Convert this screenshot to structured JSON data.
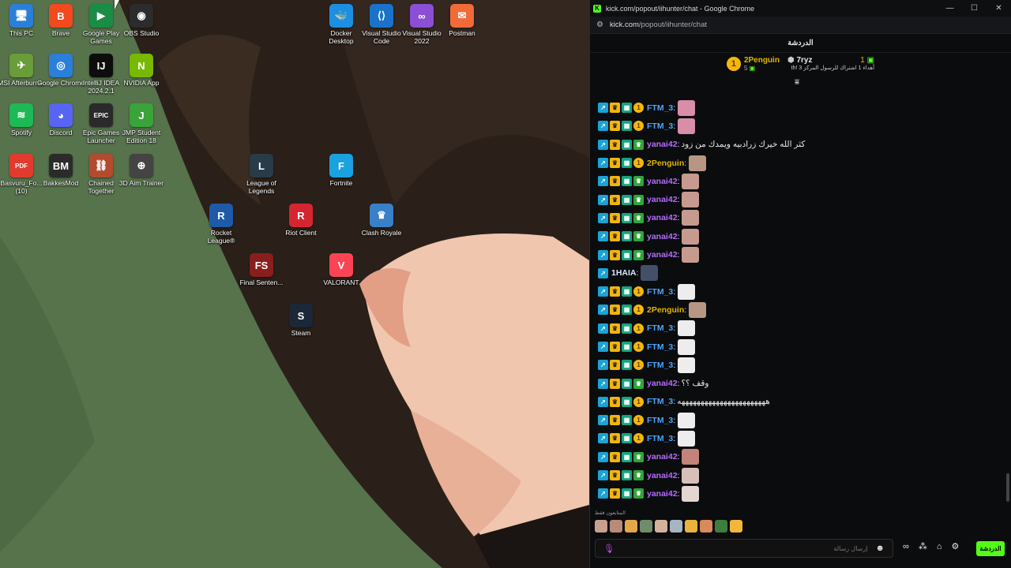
{
  "desktop": {
    "icons": [
      {
        "name": "This PC",
        "color": "#2c7fd8",
        "glyph": "🖥"
      },
      {
        "name": "Brave",
        "color": "#f04a1e",
        "glyph": "B"
      },
      {
        "name": "Google Play Games",
        "color": "#1b8c45",
        "glyph": "▶"
      },
      {
        "name": "OBS Studio",
        "color": "#2c2c2c",
        "glyph": "◉"
      },
      {
        "name": "Docker Desktop",
        "color": "#1d8fe1",
        "glyph": "🐳"
      },
      {
        "name": "Visual Studio Code",
        "color": "#1a73c9",
        "glyph": "⟨⟩"
      },
      {
        "name": "Visual Studio 2022",
        "color": "#8a4fd4",
        "glyph": "∞"
      },
      {
        "name": "Postman",
        "color": "#f06b37",
        "glyph": "✉"
      },
      {
        "name": "MSI Afterburner",
        "color": "#6a9c3a",
        "glyph": "✈"
      },
      {
        "name": "Google Chrome",
        "color": "#2b7fd8",
        "glyph": "◎"
      },
      {
        "name": "IntelliJ IDEA 2024.2.1",
        "color": "#0d0d0d",
        "glyph": "IJ"
      },
      {
        "name": "NVIDIA App",
        "color": "#76b900",
        "glyph": "N"
      },
      {
        "name": "Spotify",
        "color": "#1db954",
        "glyph": "≋"
      },
      {
        "name": "Discord",
        "color": "#5865f2",
        "glyph": "◕"
      },
      {
        "name": "Epic Games Launcher",
        "color": "#2a2a2a",
        "glyph": "EPIC"
      },
      {
        "name": "JMP Student Edition 18",
        "color": "#3aa33a",
        "glyph": "J"
      },
      {
        "name": "Basvuru_Fo... (10)",
        "color": "#e23b2e",
        "glyph": "PDF"
      },
      {
        "name": "BakkesMod",
        "color": "#2b2b2b",
        "glyph": "BM"
      },
      {
        "name": "Chained Together",
        "color": "#b34b2e",
        "glyph": "⛓"
      },
      {
        "name": "3D Aim Trainer",
        "color": "#444",
        "glyph": "⊕"
      },
      {
        "name": "League of Legends",
        "color": "#2a3b48",
        "glyph": "L"
      },
      {
        "name": "Fortnite",
        "color": "#1aa2e0",
        "glyph": "F"
      },
      {
        "name": "Rocket League®",
        "color": "#1e5aa8",
        "glyph": "R"
      },
      {
        "name": "Riot Client",
        "color": "#d42631",
        "glyph": "R"
      },
      {
        "name": "Clash Royale",
        "color": "#3a80c8",
        "glyph": "♛"
      },
      {
        "name": "Final Senten...",
        "color": "#8a1e1e",
        "glyph": "FS"
      },
      {
        "name": "VALORANT",
        "color": "#fa4454",
        "glyph": "V"
      },
      {
        "name": "Steam",
        "color": "#1b2838",
        "glyph": "S"
      }
    ]
  },
  "window": {
    "title": "kick.com/popout/iihunter/chat - Google Chrome",
    "favicon": "K",
    "min": "—",
    "max": "☐",
    "close": "✕",
    "url_host": "kick.com",
    "url_path": "/popout/iihunter/chat"
  },
  "chat": {
    "header": "الدردشة",
    "pinned": {
      "gifter_user": "2Penguin",
      "gifter_count": "5",
      "coin_value": "1",
      "target_user": "7ryz",
      "target_count": "1",
      "message": "أهداء 1 اشتراك للرسول المركز 3 !th"
    },
    "messages": [
      {
        "user": "FTM_3",
        "color": "#4aa6ff",
        "badge": "coin",
        "text": "",
        "emote": "#d98ea8"
      },
      {
        "user": "FTM_3",
        "color": "#4aa6ff",
        "badge": "coin",
        "text": "",
        "emote": "#d98ea8"
      },
      {
        "user": "yanai42",
        "color": "#b46cff",
        "badge": "sub",
        "text": "كثر الله خيرك زرادبيه ويمدك من زود",
        "emote": ""
      },
      {
        "user": "2Penguin",
        "color": "#e0b400",
        "badge": "coin",
        "text": "",
        "emote": "#b79783"
      },
      {
        "user": "yanai42",
        "color": "#b46cff",
        "badge": "sub",
        "text": "",
        "emote": "#c79a8f"
      },
      {
        "user": "yanai42",
        "color": "#b46cff",
        "badge": "sub",
        "text": "",
        "emote": "#c79a8f"
      },
      {
        "user": "yanai42",
        "color": "#b46cff",
        "badge": "sub",
        "text": "",
        "emote": "#c79a8f"
      },
      {
        "user": "yanai42",
        "color": "#b46cff",
        "badge": "sub",
        "text": "",
        "emote": "#c79a8f"
      },
      {
        "user": "yanai42",
        "color": "#b46cff",
        "badge": "sub",
        "text": "",
        "emote": "#c79a8f"
      },
      {
        "user": "1HAIA",
        "color": "#d9e6ff",
        "badge": "none",
        "text": "",
        "emote": "#44506a"
      },
      {
        "user": "FTM_3",
        "color": "#4aa6ff",
        "badge": "coin",
        "text": "",
        "emote": "#ededed"
      },
      {
        "user": "2Penguin",
        "color": "#e0b400",
        "badge": "coin",
        "text": "",
        "emote": "#b79783"
      },
      {
        "user": "FTM_3",
        "color": "#4aa6ff",
        "badge": "coin",
        "text": "",
        "emote": "#ededed"
      },
      {
        "user": "FTM_3",
        "color": "#4aa6ff",
        "badge": "coin",
        "text": "",
        "emote": "#ededed"
      },
      {
        "user": "FTM_3",
        "color": "#4aa6ff",
        "badge": "coin",
        "text": "",
        "emote": "#ededed"
      },
      {
        "user": "yanai42",
        "color": "#b46cff",
        "badge": "sub",
        "text": "وقف ؟؟",
        "emote": ""
      },
      {
        "user": "FTM_3",
        "color": "#4aa6ff",
        "badge": "coin",
        "text": "هههههههههههههههههههههههه",
        "emote": ""
      },
      {
        "user": "FTM_3",
        "color": "#4aa6ff",
        "badge": "coin",
        "text": "",
        "emote": "#ededed"
      },
      {
        "user": "FTM_3",
        "color": "#4aa6ff",
        "badge": "coin",
        "text": "",
        "emote": "#ededed"
      },
      {
        "user": "yanai42",
        "color": "#b46cff",
        "badge": "sub",
        "text": "",
        "emote": "#c3837a"
      },
      {
        "user": "yanai42",
        "color": "#b46cff",
        "badge": "sub",
        "text": "",
        "emote": "#d7c0b8"
      },
      {
        "user": "yanai42",
        "color": "#b46cff",
        "badge": "sub",
        "text": "",
        "emote": "#e4d6d0"
      }
    ],
    "emote_label": "المتابعون فقط",
    "emote_bar": [
      "#c9a08e",
      "#b98a77",
      "#e5a64a",
      "#6f8d6a",
      "#d4b39b",
      "#a6b5c2",
      "#e9b33c",
      "#d9895a",
      "#3d7d3d",
      "#f2b63a"
    ],
    "input_placeholder": "إرسال رسالة",
    "send_label": "الدردشة"
  }
}
